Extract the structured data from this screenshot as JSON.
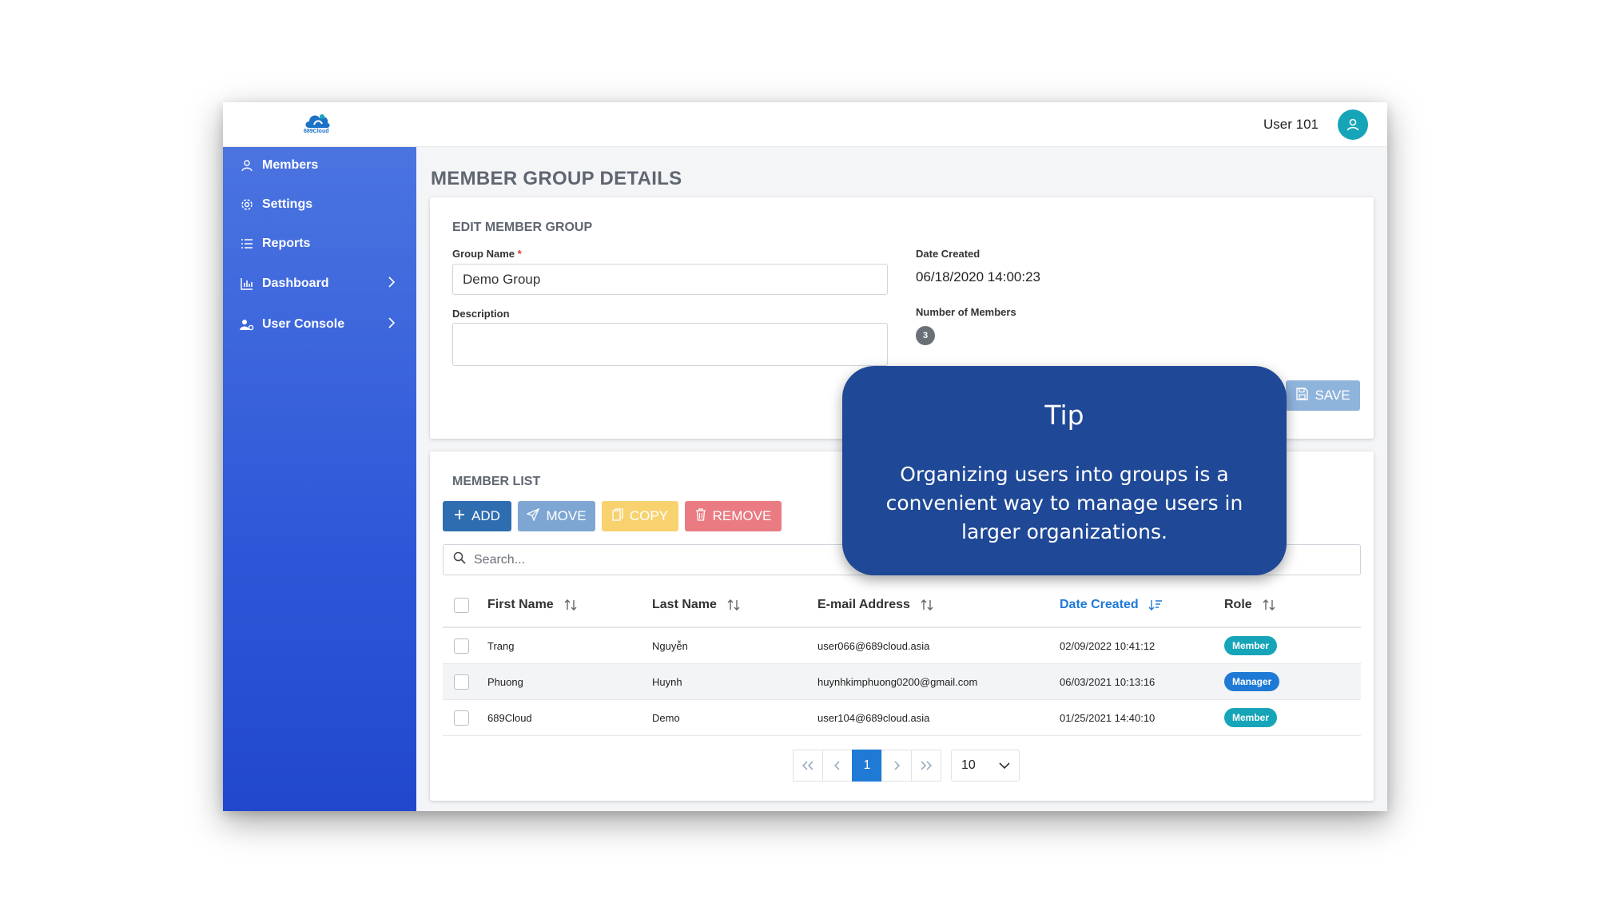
{
  "header": {
    "logo_text": "689Cloud",
    "username": "User 101"
  },
  "sidebar": {
    "items": [
      {
        "label": "Members",
        "icon": "user-icon"
      },
      {
        "label": "Settings",
        "icon": "gear-icon"
      },
      {
        "label": "Reports",
        "icon": "list-icon"
      },
      {
        "label": "Dashboard",
        "icon": "bar-chart-icon",
        "expandable": true
      },
      {
        "label": "User Console",
        "icon": "user-gear-icon",
        "expandable": true
      }
    ]
  },
  "page": {
    "title": "MEMBER GROUP DETAILS"
  },
  "edit_group": {
    "section_title": "EDIT MEMBER GROUP",
    "group_name_label": "Group Name",
    "required_mark": "*",
    "group_name_value": "Demo Group",
    "description_label": "Description",
    "description_value": "",
    "date_created_label": "Date Created",
    "date_created_value": "06/18/2020 14:00:23",
    "member_count_label": "Number of Members",
    "member_count_value": "3",
    "save_label": "SAVE"
  },
  "member_list": {
    "section_title": "MEMBER LIST",
    "buttons": {
      "add": "ADD",
      "move": "MOVE",
      "copy": "COPY",
      "remove": "REMOVE"
    },
    "search_placeholder": "Search...",
    "columns": [
      "First Name",
      "Last Name",
      "E-mail Address",
      "Date Created",
      "Role"
    ],
    "sorted_column": "Date Created",
    "rows": [
      {
        "first": "Trang",
        "last": "Nguyễn",
        "email": "user066@689cloud.asia",
        "created": "02/09/2022 10:41:12",
        "role": "Member"
      },
      {
        "first": "Phuong",
        "last": "Huynh",
        "email": "huynhkimphuong0200@gmail.com",
        "created": "06/03/2021 10:13:16",
        "role": "Manager"
      },
      {
        "first": "689Cloud",
        "last": "Demo",
        "email": "user104@689cloud.asia",
        "created": "01/25/2021 14:40:10",
        "role": "Member"
      }
    ],
    "pagination": {
      "current_page": "1",
      "per_page": "10"
    }
  },
  "tip": {
    "title": "Tip",
    "body": "Organizing users into groups is a convenient way to manage users in larger organizations."
  },
  "colors": {
    "sidebar_top": "#4b74e0",
    "sidebar_bottom": "#2148cc",
    "accent_blue": "#1f7ad6",
    "teal": "#16a5b8",
    "tip_bg": "#1f4896"
  }
}
